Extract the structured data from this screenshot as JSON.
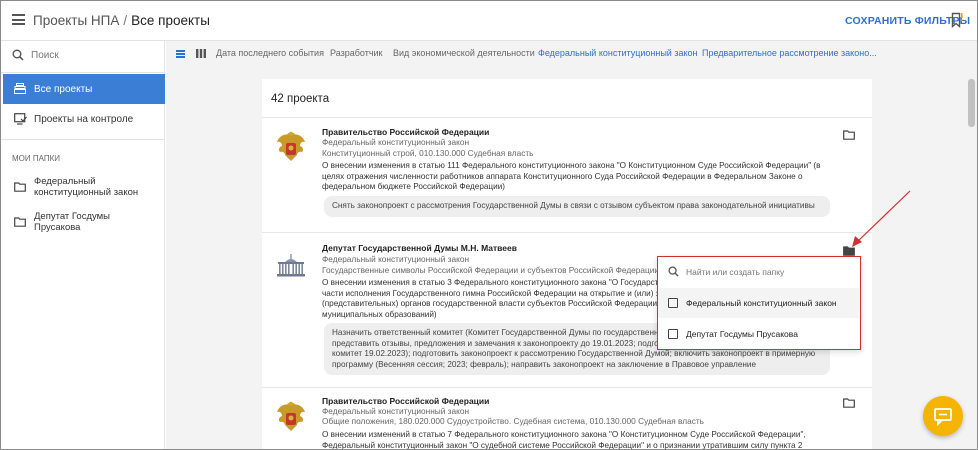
{
  "header": {
    "breadcrumb_root": "Проекты НПА",
    "breadcrumb_separator": "/",
    "breadcrumb_current": "Все проекты",
    "save_filters_label": "СОХРАНИТЬ ФИЛЬТРЫ"
  },
  "sidebar": {
    "search_placeholder": "Поиск",
    "nav": [
      {
        "label": "Все проекты",
        "icon": "stack-icon",
        "active": true
      },
      {
        "label": "Проекты на контроле",
        "icon": "monitor-check-icon",
        "active": false
      }
    ],
    "folders_title": "МОИ ПАПКИ",
    "folders": [
      {
        "label": "Федеральный конституционный закон",
        "icon": "folder-icon"
      },
      {
        "label": "Депутат Госдумы Прусакова",
        "icon": "folder-icon"
      }
    ]
  },
  "filters": {
    "chips": [
      "Дата последнего события",
      "Разработчик",
      "Вид экономической деятельности",
      "Федеральный конституционный закон",
      "Предварительное рассмотрение законо..."
    ]
  },
  "results": {
    "count_label": "42 проекта",
    "projects": [
      {
        "author": "Правительство Российской Федерации",
        "type": "Федеральный конституционный закон",
        "classifier": "Конституционный строй, 010.130.000 Судебная власть",
        "description": "О внесении изменения в статью 111 Федерального конституционного закона \"О Конституционном Суде Российской Федерации\" (в целях отражения численности работников аппарата Конституционного Суда Российской Федерации в Федеральном Законе о федеральном бюджете Российской Федерации)",
        "status": "Снять законопроект с рассмотрения Государственной Думы в связи с отзывом субъектом права законодательной инициативы",
        "emblem": "coat-of-arms-icon"
      },
      {
        "author": "Депутат Государственной Думы М.Н. Матвеев",
        "type": "Федеральный конституционный закон",
        "classifier": "Государственные символы Российской Федерации и субъектов Российской Федерации",
        "description": "О внесении изменения в статью 3 Федерального конституционного закона \"О Государственном гимне Российской Федерации\" (в части исполнения Государственного гимна Российской Федерации на открытие и (или) закрытие заседаний законодательных (представительных) органов государственной власти субъектов Российской Федерации и представительных органов муниципальных образований)",
        "status": "Назначить ответственный комитет (Комитет Государственной Думы по государственному строительству и законодательству); представить отзывы, предложения и замечания к законопроекту до 19.01.2023; подготовить предложения и замечаний в комитет 19.02.2023); подготовить законопроект к рассмотрению Государственной Думой; включить законопроект в примерную программу (Весенняя сессия; 2023; февраль); направить законопроект на заключение в Правовое управление",
        "emblem": "duma-building-icon"
      },
      {
        "author": "Правительство Российской Федерации",
        "type": "Федеральный конституционный закон",
        "classifier": "Общие положения, 180.020.000 Судоустройство. Судебная система, 010.130.000 Судебная власть",
        "description": "О внесении изменений в статью 7 Федерального конституционного закона \"О Конституционном Суде Российской Федерации\", Федеральный конституционный закон \"О судебной системе Российской Федерации\" и о признании утратившим силу пункта 2",
        "emblem": "coat-of-arms-icon"
      }
    ]
  },
  "folder_popup": {
    "search_placeholder": "Найти или создать папку",
    "options": [
      {
        "label": "Федеральный конституционный закон",
        "checked": false
      },
      {
        "label": "Депутат Госдумы Прусакова",
        "checked": false
      }
    ]
  },
  "colors": {
    "accent": "#3a7fd5",
    "link": "#2f6fd0",
    "highlight_border": "#d32f2f",
    "chat_button": "#f5b400"
  }
}
